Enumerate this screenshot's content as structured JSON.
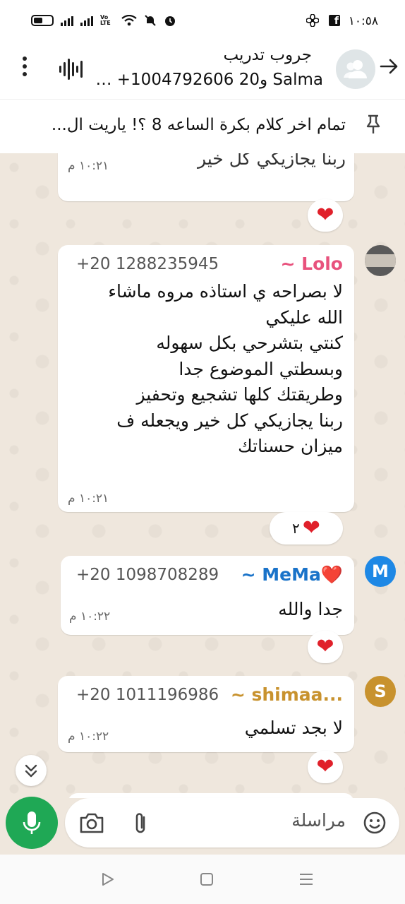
{
  "status_bar": {
    "time": "١٠:٥٨",
    "network_label": "Vo LTE"
  },
  "header": {
    "title": "جروب تدريب",
    "subtitle": "Salma و20 1004792606+ …"
  },
  "pinned": {
    "text": "تمام اخر كلام بكرة الساعه 8 ؟! ياريت ال..."
  },
  "messages": [
    {
      "partial_text": "ربنا يجازيكي كل خير",
      "time": "١٠:٢١ م",
      "reaction": "❤️"
    },
    {
      "sender": "~ Lolo",
      "sender_color": "#e8527d",
      "phone": "+20 1288235945",
      "lines": [
        "لا بصراحه ي استاذه مروه ماشاء",
        "الله عليكي",
        "كنتي بتشرحي بكل سهوله",
        "وبسطتي الموضوع جدا",
        "وطريقتك كلها تشجيع وتحفيز",
        "ربنا يجازيكي كل خير ويجعله ف",
        "ميزان حسناتك"
      ],
      "time": "١٠:٢١ م",
      "reaction": "❤️",
      "reaction_count": "٢"
    },
    {
      "sender": "~ MeMa❤️",
      "sender_color": "#1a73c9",
      "phone": "+20 1098708289",
      "text": "جدا والله",
      "time": "١٠:٢٢ م",
      "reaction": "❤️",
      "avatar_letter": "M",
      "avatar_color": "#1e88e5"
    },
    {
      "sender": "~ shimaa...",
      "sender_color": "#c8922e",
      "phone": "+20 1011196986",
      "text": "لا بجد تسلمي",
      "time": "١٠:٢٢ م",
      "reaction": "❤️",
      "avatar_letter": "S",
      "avatar_color": "#c8922e"
    }
  ],
  "composer": {
    "placeholder": "مراسلة"
  },
  "colors": {
    "accent_green": "#1fa855",
    "chat_background": "#efe7dd"
  },
  "icons": [
    "back-arrow-icon",
    "group-avatar-icon",
    "voice-call-icon",
    "more-options-icon",
    "pin-icon",
    "heart-icon",
    "scroll-down-icon",
    "mic-icon",
    "camera-icon",
    "attach-icon",
    "emoji-icon",
    "nav-back-icon",
    "nav-home-icon",
    "nav-recents-icon"
  ]
}
